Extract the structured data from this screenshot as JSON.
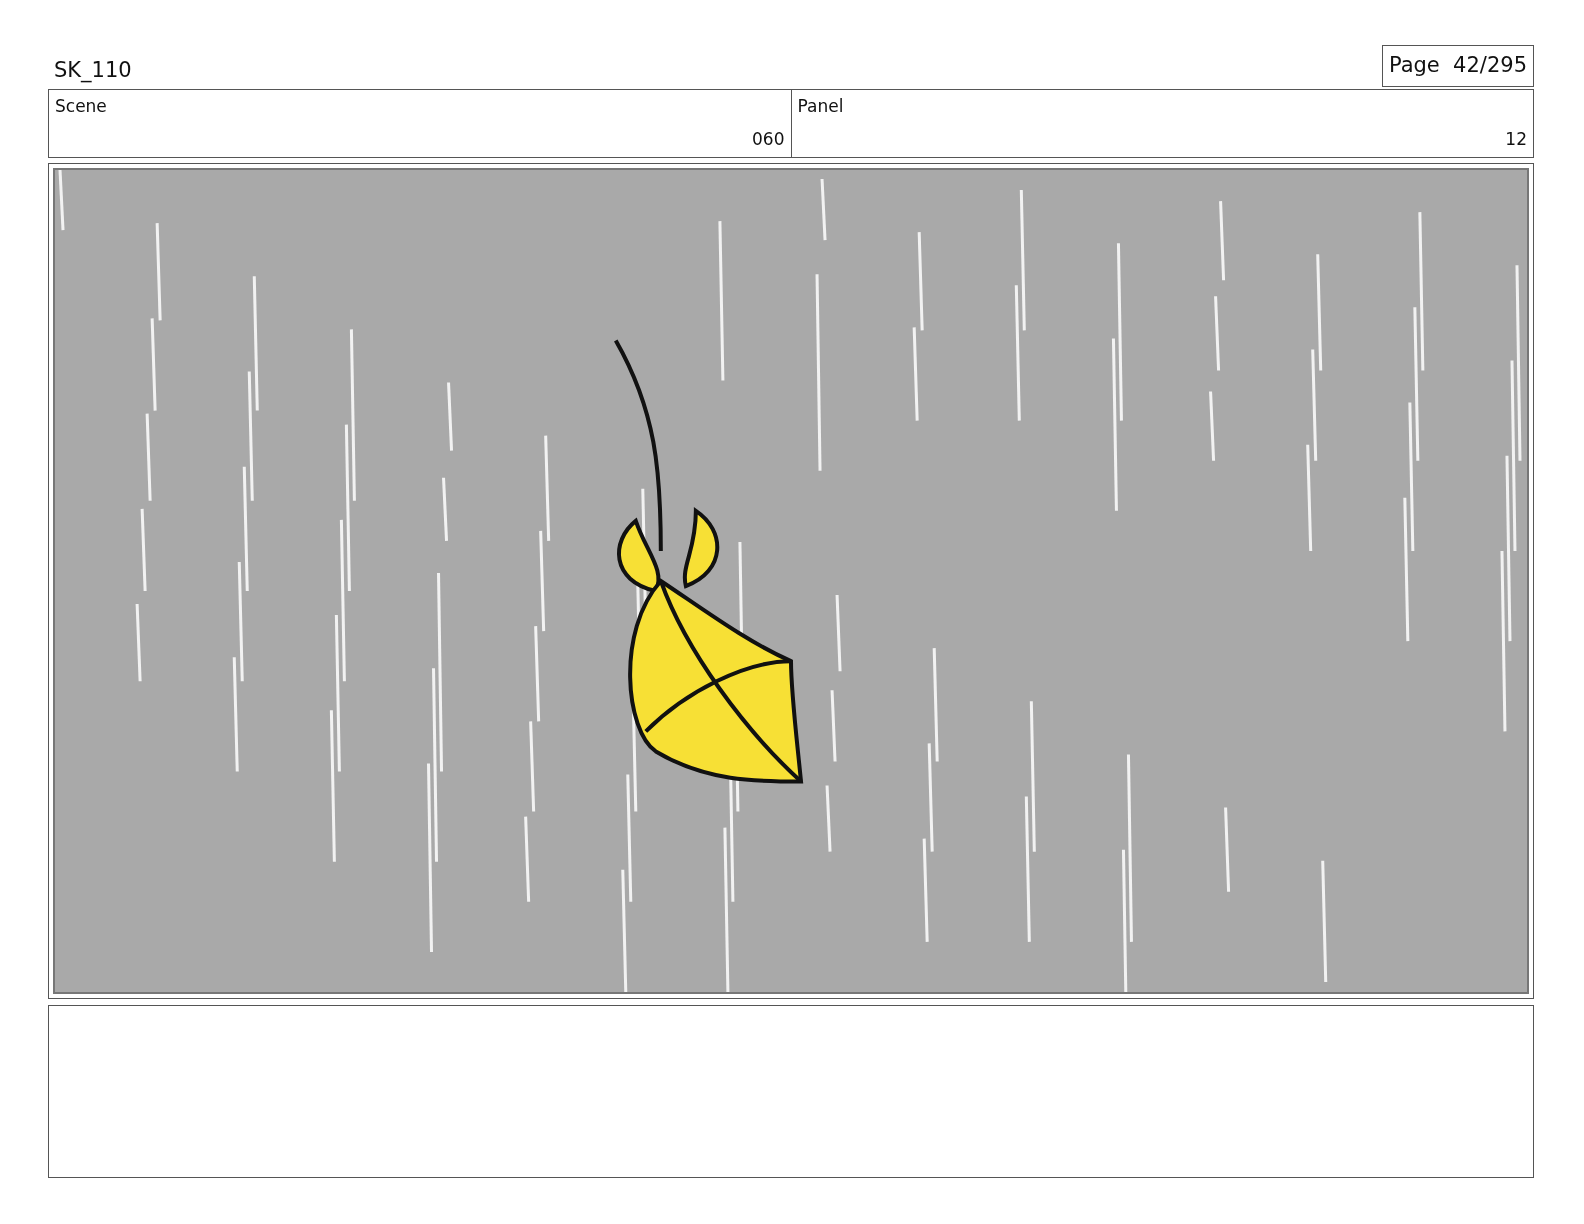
{
  "title": "SK_110",
  "page": "Page  42/295",
  "scene": {
    "label": "Scene",
    "value": "060"
  },
  "panel": {
    "label": "Panel",
    "value": "12"
  }
}
